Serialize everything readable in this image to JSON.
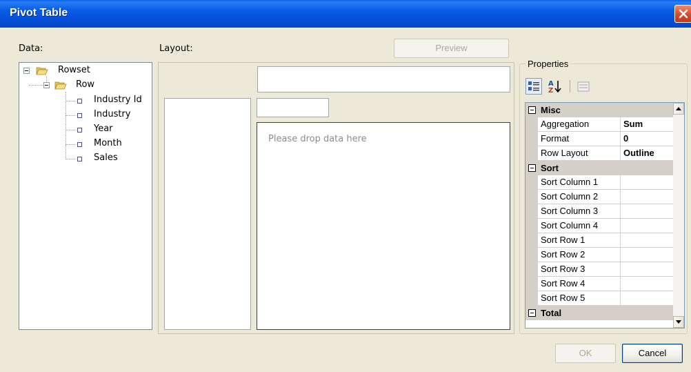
{
  "window": {
    "title": "Pivot Table"
  },
  "labels": {
    "data": "Data:",
    "layout": "Layout:"
  },
  "buttons": {
    "preview": "Preview",
    "ok": "OK",
    "cancel": "Cancel"
  },
  "tree": {
    "root": "Rowset",
    "child": "Row",
    "fields": [
      "Industry Id",
      "Industry",
      "Year",
      "Month",
      "Sales"
    ]
  },
  "layout": {
    "drop_hint": "Please drop data here"
  },
  "properties": {
    "title": "Properties",
    "toolbar_icons": [
      "categorized-icon",
      "alphabetical-sort-icon",
      "property-pages-icon"
    ],
    "categories": [
      {
        "name": "Misc",
        "rows": [
          {
            "name": "Aggregation",
            "value": "Sum"
          },
          {
            "name": "Format",
            "value": "0"
          },
          {
            "name": "Row Layout",
            "value": "Outline"
          }
        ]
      },
      {
        "name": "Sort",
        "rows": [
          {
            "name": "Sort Column 1",
            "value": ""
          },
          {
            "name": "Sort Column 2",
            "value": ""
          },
          {
            "name": "Sort Column 3",
            "value": ""
          },
          {
            "name": "Sort Column 4",
            "value": ""
          },
          {
            "name": "Sort Row 1",
            "value": ""
          },
          {
            "name": "Sort Row 2",
            "value": ""
          },
          {
            "name": "Sort Row 3",
            "value": ""
          },
          {
            "name": "Sort Row 4",
            "value": ""
          },
          {
            "name": "Sort Row 5",
            "value": ""
          }
        ]
      },
      {
        "name": "Total",
        "rows": []
      }
    ]
  },
  "colors": {
    "titlebar": "#0a5de8",
    "dialog_bg": "#ece9d8",
    "disabled_text": "#aca899"
  }
}
